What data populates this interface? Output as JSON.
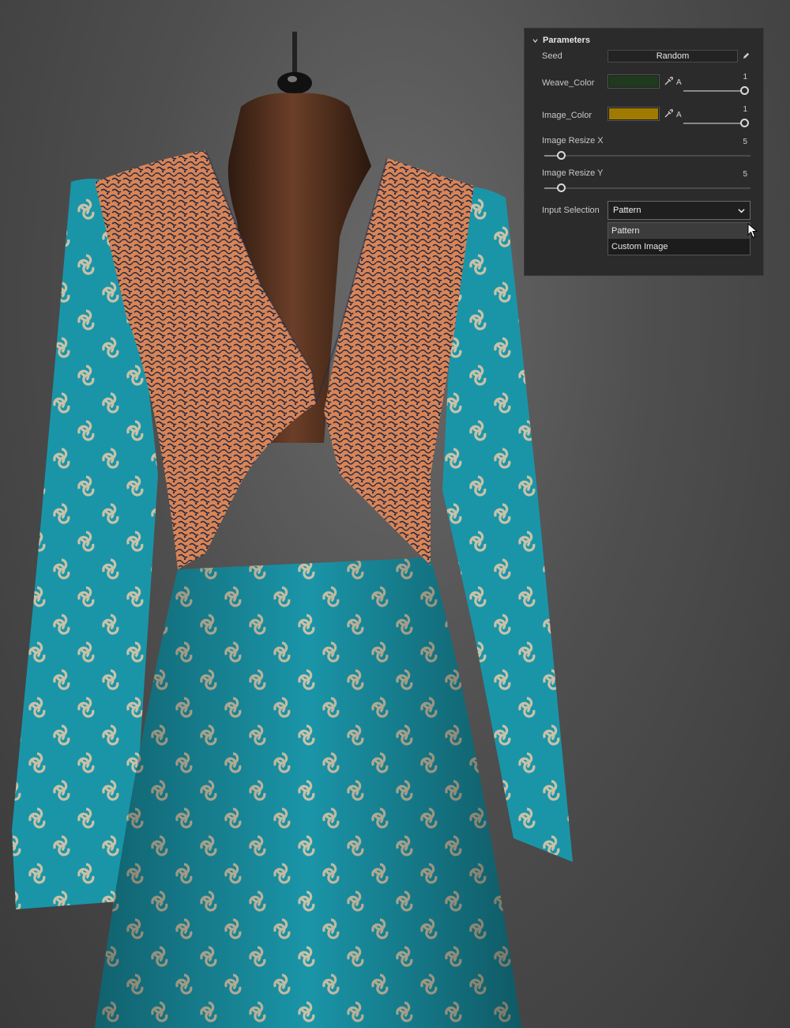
{
  "panel": {
    "title": "Parameters",
    "seed": {
      "label": "Seed",
      "button": "Random"
    },
    "weave_color": {
      "label": "Weave_Color",
      "color": "#1f3a1f",
      "alpha_label": "A",
      "alpha_value": "1"
    },
    "image_color": {
      "label": "Image_Color",
      "color": "#a07a00",
      "alpha_label": "A",
      "alpha_value": "1"
    },
    "resize_x": {
      "label": "Image Resize X",
      "value": "5"
    },
    "resize_y": {
      "label": "Image Resize Y",
      "value": "5"
    },
    "input_selection": {
      "label": "Input Selection",
      "value": "Pattern",
      "options": [
        "Pattern",
        "Custom Image"
      ]
    }
  },
  "scene": {
    "colors": {
      "dress": "#1a95a8",
      "bodice": "#d98455",
      "bodice_dark": "#1f2a48",
      "form": "#5a3322",
      "motif": "#c9c2a8"
    }
  },
  "icons": {
    "collapse": "chevron-down-icon",
    "edit": "pencil-icon",
    "eyedropper": "eyedropper-icon",
    "dropdown": "chevron-down-icon",
    "cursor": "mouse-cursor-icon"
  }
}
